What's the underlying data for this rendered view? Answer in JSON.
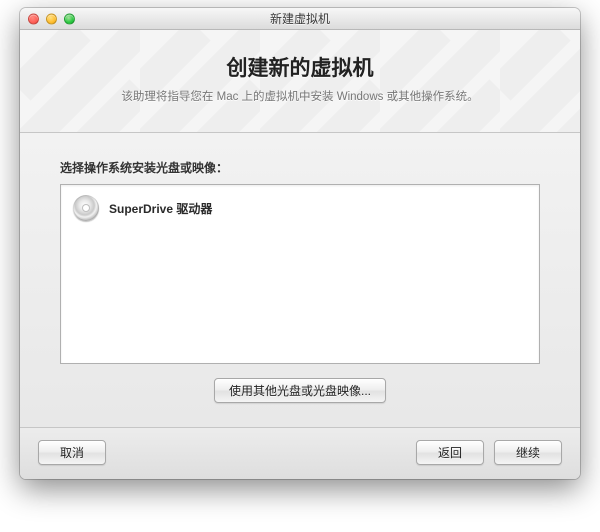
{
  "window": {
    "title": "新建虚拟机"
  },
  "header": {
    "title": "创建新的虚拟机",
    "subtitle": "该助理将指导您在 Mac 上的虚拟机中安装 Windows 或其他操作系统。"
  },
  "section": {
    "label": "选择操作系统安装光盘或映像："
  },
  "list": {
    "items": [
      {
        "label": "SuperDrive 驱动器",
        "icon": "disc-icon"
      }
    ]
  },
  "buttons": {
    "use_other": "使用其他光盘或光盘映像...",
    "cancel": "取消",
    "back": "返回",
    "continue": "继续"
  }
}
